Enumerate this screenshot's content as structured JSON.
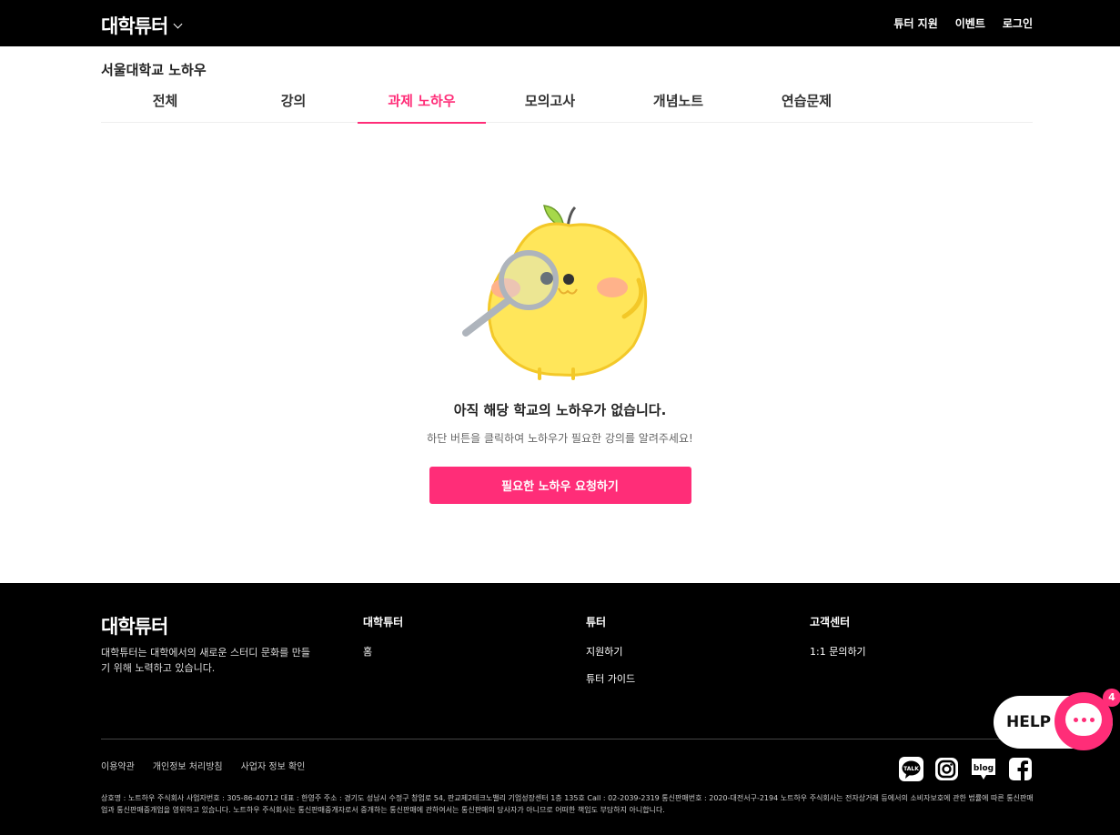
{
  "header": {
    "logo": "대학튜터",
    "nav": [
      "튜터 지원",
      "이벤트",
      "로그인"
    ]
  },
  "school_title": "서울대학교 노하우",
  "tabs": [
    {
      "label": "전체",
      "active": false
    },
    {
      "label": "강의",
      "active": false
    },
    {
      "label": "과제 노하우",
      "active": true
    },
    {
      "label": "모의고사",
      "active": false
    },
    {
      "label": "개념노트",
      "active": false
    },
    {
      "label": "연습문제",
      "active": false
    }
  ],
  "empty_state": {
    "title": "아직 해당 학교의 노하우가 없습니다.",
    "subtitle": "하단 버튼을 클릭하여 노하우가 필요한 강의를 알려주세요!",
    "button": "필요한 노하우 요청하기"
  },
  "footer": {
    "logo": "대학튜터",
    "description": "대학튜터는 대학에서의 새로운 스터디 문화를 만들기 위해 노력하고 있습니다.",
    "columns": [
      {
        "title": "대학튜터",
        "links": [
          "홈"
        ]
      },
      {
        "title": "튜터",
        "links": [
          "지원하기",
          "튜터 가이드"
        ]
      },
      {
        "title": "고객센터",
        "links": [
          "1:1 문의하기"
        ]
      }
    ],
    "bottom_links": [
      "이용약관",
      "개인정보 처리방침",
      "사업자 정보 확인"
    ],
    "social": [
      "kakao-talk-icon",
      "instagram-icon",
      "blog-icon",
      "facebook-icon"
    ],
    "social_labels": {
      "kakao": "TALK",
      "blog": "blog"
    },
    "legal": "상호명 : 노트하우 주식회사 사업자번호 : 305-86-40712 대표 : 한영주 주소 : 경기도 성남시 수정구 창업로 54, 판교제2테크노밸리 기업성장센터 1층 135호 Call : 02-2039-2319 통신판매번호 : 2020-대전서구-2194 노트하우 주식회사는 전자상거래 등에서의 소비자보호에 관한 법률에 따른 통신판매업과 통신판매중개업을 영위하고 있습니다. 노트하우 주식회사는 통신판매중개자로서 중개하는 통신판매에 관하여서는 통신판매의 당사자가 아니므로 어떠한 책임도 부담하지 아니합니다."
  },
  "help": {
    "label": "HELP",
    "badge": "4"
  },
  "colors": {
    "accent": "#ff2d78",
    "header_bg": "#000000",
    "footer_bg": "#000000"
  }
}
